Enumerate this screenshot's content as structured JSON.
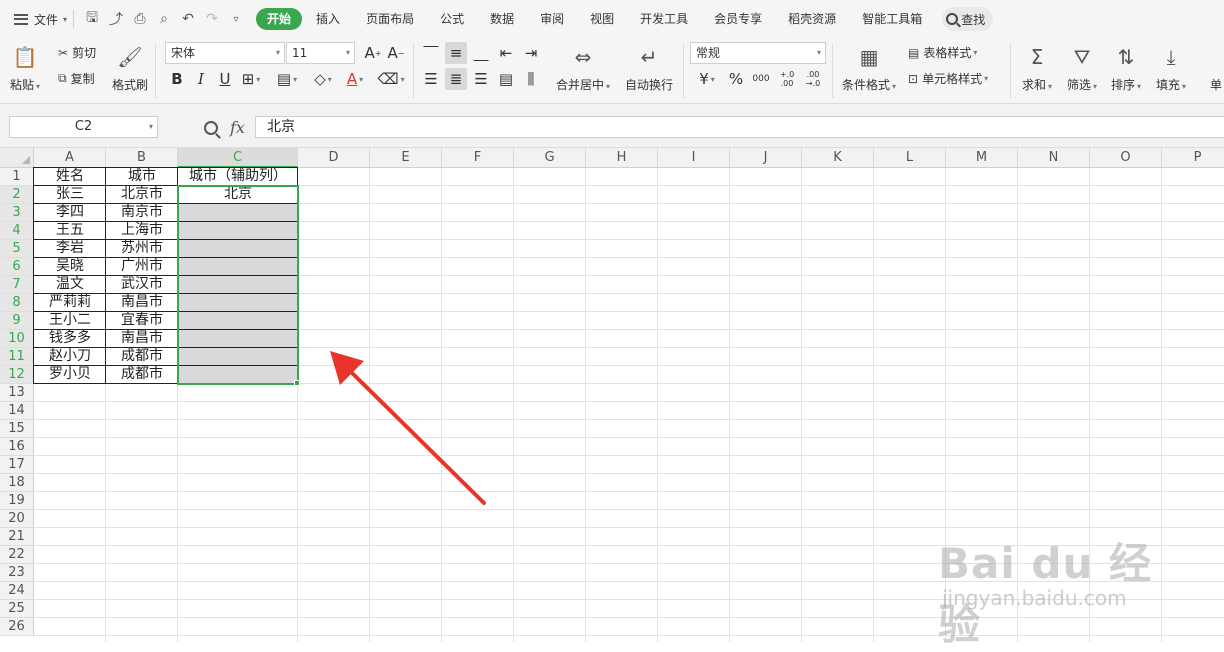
{
  "menubar": {
    "file_label": "文件",
    "tabs": [
      "开始",
      "插入",
      "页面布局",
      "公式",
      "数据",
      "审阅",
      "视图",
      "开发工具",
      "会员专享",
      "稻壳资源",
      "智能工具箱"
    ],
    "active_tab": "开始",
    "search_label": "查找"
  },
  "ribbon": {
    "paste": "粘贴",
    "cut": "剪切",
    "copy": "复制",
    "format_painter": "格式刷",
    "font_name": "宋体",
    "font_size": "11",
    "bold": "B",
    "italic": "I",
    "underline": "U",
    "merge_center": "合并居中",
    "wrap_text": "自动换行",
    "number_format": "常规",
    "currency": "¥",
    "percent": "%",
    "thousands": "000",
    "inc_decimal": "+.0 .00",
    "dec_decimal": ".00 →.0",
    "conditional_format": "条件格式",
    "table_style": "表格样式",
    "cell_style": "单元格样式",
    "sum": "求和",
    "filter": "筛选",
    "sort": "排序",
    "fill": "填充",
    "single": "单"
  },
  "formula_bar": {
    "name_box": "C2",
    "fx": "fx",
    "value": "北京"
  },
  "sheet": {
    "columns": [
      "A",
      "B",
      "C",
      "D",
      "E",
      "F",
      "G",
      "H",
      "I",
      "J",
      "K",
      "L",
      "M",
      "N",
      "O",
      "P"
    ],
    "rows": [
      "1",
      "2",
      "3",
      "4",
      "5",
      "6",
      "7",
      "8",
      "9",
      "10",
      "11",
      "12",
      "13",
      "14",
      "15",
      "16",
      "17",
      "18",
      "19",
      "20",
      "21",
      "22",
      "23",
      "24",
      "25",
      "26"
    ],
    "selected_column": "C",
    "header": [
      "姓名",
      "城市",
      "城市（辅助列）"
    ],
    "data": [
      [
        "张三",
        "北京市",
        "北京"
      ],
      [
        "李四",
        "南京市",
        ""
      ],
      [
        "王五",
        "上海市",
        ""
      ],
      [
        "李岩",
        "苏州市",
        ""
      ],
      [
        "吴晓",
        "广州市",
        ""
      ],
      [
        "温文",
        "武汉市",
        ""
      ],
      [
        "严莉莉",
        "南昌市",
        ""
      ],
      [
        "王小二",
        "宜春市",
        ""
      ],
      [
        "钱多多",
        "南昌市",
        ""
      ],
      [
        "赵小刀",
        "成都市",
        ""
      ],
      [
        "罗小贝",
        "成都市",
        ""
      ]
    ]
  },
  "watermark": {
    "brand": "Bai du 经验",
    "url": "jingyan.baidu.com"
  },
  "colors": {
    "accent": "#3aa650",
    "arrow": "#e8342a",
    "selection_fill": "#d9d9d9"
  }
}
